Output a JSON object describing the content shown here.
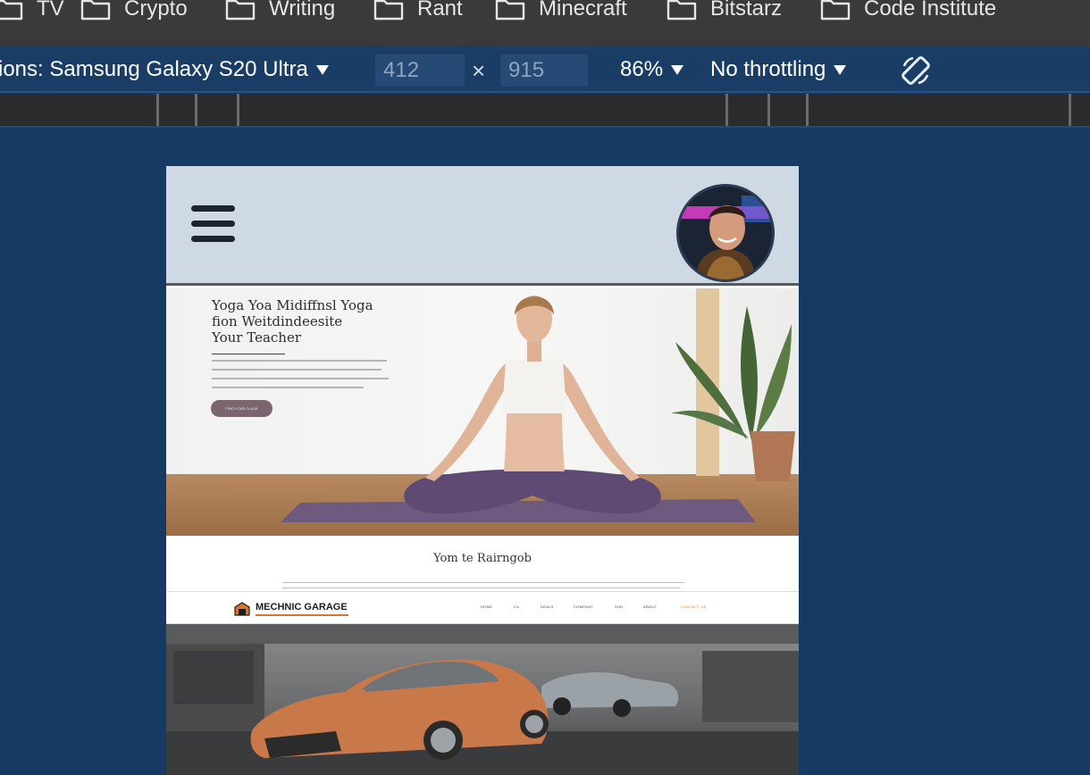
{
  "bookmarks": [
    {
      "label": "TV",
      "icon": "folder-icon"
    },
    {
      "label": "Crypto",
      "icon": "folder-icon"
    },
    {
      "label": "Writing",
      "icon": "folder-icon"
    },
    {
      "label": "Rant",
      "icon": "folder-icon"
    },
    {
      "label": "Minecraft",
      "icon": "folder-icon"
    },
    {
      "label": "Bitstarz",
      "icon": "folder-icon"
    },
    {
      "label": "Code Institute",
      "icon": "folder-icon"
    }
  ],
  "device_toolbar": {
    "dimensions_label": "ions: Samsung Galaxy S20 Ultra",
    "width": "412",
    "times": "×",
    "height": "915",
    "zoom": "86%",
    "throttling": "No throttling",
    "rotate_icon": "rotate-device-icon"
  },
  "site": {
    "menu_icon": "hamburger-menu-icon",
    "hero": {
      "title_line1": "Yoga Yoa Midiffnsl Yoga",
      "title_line2": "fion Weitdindeesite",
      "title_line3": "Your Teacher",
      "button": "FIND YOUR CLASS"
    },
    "section_title": "Yom te Rairngob",
    "garage": {
      "brand": "MECHNIC GARAGE",
      "nav": [
        "HOME",
        "CA",
        "DEALS",
        "COMPANY",
        "SHD",
        "ABOUT",
        "CONTACT US"
      ]
    }
  },
  "colors": {
    "page_bg": "#163a63",
    "bookmarks_bg": "#3a3a3c",
    "toolbar_bg": "#1a3d66",
    "site_header_bg": "#cfd9e3",
    "accent_orange": "#d8742f"
  }
}
